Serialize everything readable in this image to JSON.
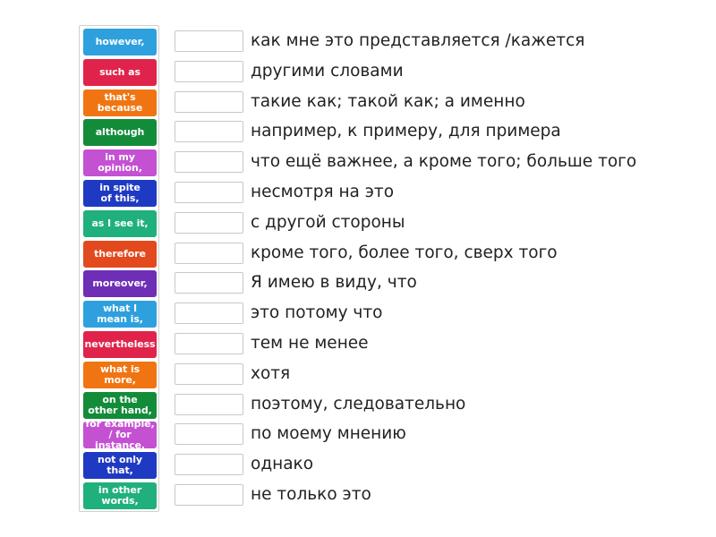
{
  "tiles": [
    {
      "label": "however,",
      "color": "#2fa0de"
    },
    {
      "label": "such as",
      "color": "#e0234a"
    },
    {
      "label": "that's\nbecause",
      "color": "#f07512"
    },
    {
      "label": "although",
      "color": "#138c3a"
    },
    {
      "label": "in my\nopinion,",
      "color": "#c451d2"
    },
    {
      "label": "in spite\nof this,",
      "color": "#1f3ac2"
    },
    {
      "label": "as I see it,",
      "color": "#20b07c"
    },
    {
      "label": "therefore",
      "color": "#e24a1e"
    },
    {
      "label": "moreover,",
      "color": "#6e2fb6"
    },
    {
      "label": "what I\nmean is,",
      "color": "#2fa0de"
    },
    {
      "label": "nevertheless",
      "color": "#e0234a"
    },
    {
      "label": "what is\nmore,",
      "color": "#f07512"
    },
    {
      "label": "on the\nother hand,",
      "color": "#138c3a"
    },
    {
      "label": "for example,\n/ for instance,",
      "color": "#c451d2"
    },
    {
      "label": "not only that,",
      "color": "#1f3ac2"
    },
    {
      "label": "in other\nwords,",
      "color": "#20b07c"
    }
  ],
  "rows": [
    {
      "clue": "как мне это представляется /кажется"
    },
    {
      "clue": "другими словами"
    },
    {
      "clue": "такие как; такой как; а именно"
    },
    {
      "clue": "например, к примеру, для примера"
    },
    {
      "clue": "что ещё важнее, а кроме того; больше того"
    },
    {
      "clue": "несмотря на это"
    },
    {
      "clue": "с другой стороны"
    },
    {
      "clue": "кроме того, более того, сверх того"
    },
    {
      "clue": "Я имею в виду, что"
    },
    {
      "clue": "это потому что"
    },
    {
      "clue": "тем не менее"
    },
    {
      "clue": "хотя"
    },
    {
      "clue": "поэтому, следовательно"
    },
    {
      "clue": "по моему мнению"
    },
    {
      "clue": "однако"
    },
    {
      "clue": "не только это"
    }
  ]
}
